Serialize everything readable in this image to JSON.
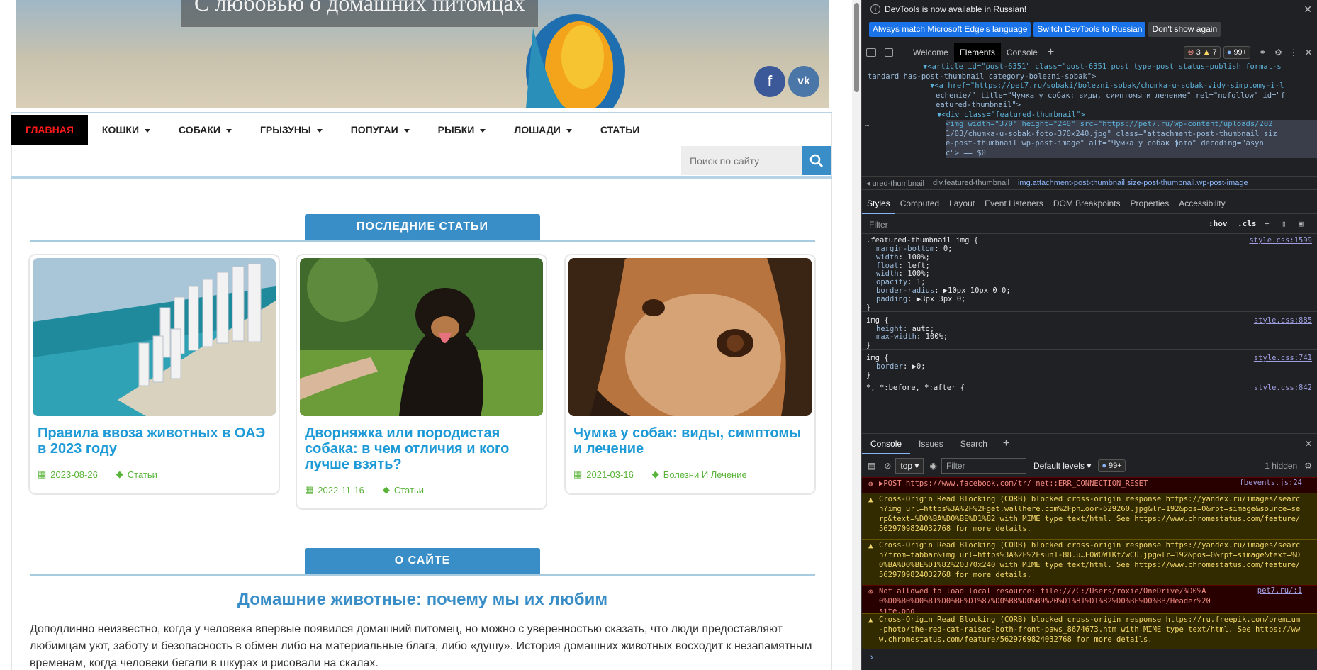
{
  "site": {
    "hero_title": "С любовью о домашних питомцах",
    "social": {
      "fb": "f",
      "vk": "vk"
    },
    "nav": [
      {
        "label": "ГЛАВНАЯ",
        "caret": false,
        "active": true
      },
      {
        "label": "КОШКИ",
        "caret": true
      },
      {
        "label": "СОБАКИ",
        "caret": true
      },
      {
        "label": "ГРЫЗУНЫ",
        "caret": true
      },
      {
        "label": "ПОПУГАИ",
        "caret": true
      },
      {
        "label": "РЫБКИ",
        "caret": true
      },
      {
        "label": "ЛОШАДИ",
        "caret": true
      },
      {
        "label": "СТАТЬИ",
        "caret": false
      }
    ],
    "search_placeholder": "Поиск по сайту",
    "latest_header": "ПОСЛЕДНИЕ СТАТЬИ",
    "articles": [
      {
        "title": "Правила ввоза животных в ОАЭ в 2023 году",
        "date": "2023-08-26",
        "category": "Статьи"
      },
      {
        "title": "Дворняжка или породистая собака: в чем отличия и кого лучше взять?",
        "date": "2022-11-16",
        "category": "Статьи"
      },
      {
        "title": "Чумка у собак: виды, симптомы и лечение",
        "date": "2021-03-16",
        "category": "Болезни И Лечение"
      }
    ],
    "about_header": "О САЙТЕ",
    "about_title": "Домашние животные: почему мы их любим",
    "about_text": "Доподлинно  неизвестно, когда у человека впервые появился домашний питомец, но можно с уверенностью сказать, что люди предоставляют любимцам уют, заботу и безопасность в обмен либо на материальные блага, либо «душу». История домашних животных восходит к незапамятным временам, когда человеки бегали в шкурах и рисовали на скалах."
  },
  "devtools": {
    "notice": "DevTools is now available in Russian!",
    "notice_info_icon": "i",
    "btn_match": "Always match Microsoft Edge's language",
    "btn_switch": "Switch DevTools to Russian",
    "btn_dont": "Don't show again",
    "tabs": [
      "Welcome",
      "Elements",
      "Console"
    ],
    "errors": "3",
    "warnings": "7",
    "messages": "99+",
    "dom_lines": [
      {
        "t": "▼<article id=\"post-6351\" class=\"post-6351 post type-post status-publish format-s"
      },
      {
        "t": "tandard has-post-thumbnail category-bolezni-sobak\">"
      },
      {
        "t": "▼<a href=\"https://pet7.ru/sobaki/bolezni-sobak/chumka-u-sobak-vidy-simptomy-i-l"
      },
      {
        "t": "echenie/\" title=\"Чумка у собак: виды, симптомы и лечение\" rel=\"nofollow\" id=\"f"
      },
      {
        "t": "eatured-thumbnail\">"
      },
      {
        "t": "▼<div class=\"featured-thumbnail\">"
      },
      {
        "t": "<img width=\"370\" height=\"240\" src=\"https://pet7.ru/wp-content/uploads/202"
      },
      {
        "t": "1/03/chumka-u-sobak-foto-370x240.jpg\" class=\"attachment-post-thumbnail siz"
      },
      {
        "t": "e-post-thumbnail wp-post-image\" alt=\"Чумка у собак фото\" decoding=\"asyn"
      },
      {
        "t": "c\"> == $0"
      }
    ],
    "crumbs": [
      "◂ ured-thumbnail",
      "div.featured-thumbnail",
      "img.attachment-post-thumbnail.size-post-thumbnail.wp-post-image"
    ],
    "style_tabs": [
      "Styles",
      "Computed",
      "Layout",
      "Event Listeners",
      "DOM Breakpoints",
      "Properties",
      "Accessibility"
    ],
    "filter_placeholder": "Filter",
    "hov": ":hov",
    "cls": ".cls",
    "rules": [
      {
        "selector": ".featured-thumbnail img {",
        "source": "style.css:1599",
        "props": [
          [
            "margin-bottom",
            "0;",
            false
          ],
          [
            "width",
            "100%;",
            true
          ],
          [
            "float",
            "left;",
            false
          ],
          [
            "width",
            "100%;",
            false
          ],
          [
            "opacity",
            "1;",
            false
          ],
          [
            "border-radius",
            "▶10px 10px 0 0;",
            false
          ],
          [
            "padding",
            "▶3px 3px 0;",
            false
          ]
        ]
      },
      {
        "selector": "img {",
        "source": "style.css:885",
        "props": [
          [
            "height",
            "auto;",
            false
          ],
          [
            "max-width",
            "100%;",
            false
          ]
        ]
      },
      {
        "selector": "img {",
        "source": "style.css:741",
        "props": [
          [
            "border",
            "▶0;",
            false
          ]
        ]
      },
      {
        "selector": "*, *:before, *:after {",
        "source": "style.css:842",
        "props": []
      }
    ],
    "console_tabs": [
      "Console",
      "Issues",
      "Search"
    ],
    "context": "top",
    "console_filter": "Filter",
    "levels": "Default levels",
    "console_count": "99+",
    "hidden": "1 hidden",
    "console_msgs": [
      {
        "type": "err",
        "text": "▶POST https://www.facebook.com/tr/ net::ERR_CONNECTION_RESET",
        "src": "fbevents.js:24"
      },
      {
        "type": "warn",
        "text": "Cross-Origin Read Blocking (CORB) blocked cross-origin response https://yandex.ru/images/search?img_url=https%3A%2F%2Fget.wallhere.com%2Fph…oor-629260.jpg&lr=192&pos=0&rpt=simage&source=serp&text=%D0%BA%D0%BE%D1%82 with MIME type text/html. See https://www.chromestatus.com/feature/5629709824032768 for more details.",
        "src": ""
      },
      {
        "type": "warn",
        "text": "Cross-Origin Read Blocking (CORB) blocked cross-origin response https://yandex.ru/images/search?from=tabbar&img_url=https%3A%2F%2Fsun1-88.u…F0WOW1KfZwCU.jpg&lr=192&pos=0&rpt=simage&text=%D0%BA%D0%BE%D1%82%20370x240 with MIME type text/html. See https://www.chromestatus.com/feature/5629709824032768 for more details.",
        "src": ""
      },
      {
        "type": "err",
        "text": "Not allowed to load local resource: file:///C:/Users/roxie/OneDrive/%D0%A0%D0%B0%D0%B1%D0%BE%D1%87%D0%B8%D0%B9%20%D1%81%D1%82%D0%BE%D0%BB/Header%20site.png",
        "src": "pet7.ru/:1"
      },
      {
        "type": "warn",
        "text": "Cross-Origin Read Blocking (CORB) blocked cross-origin response https://ru.freepik.com/premium-photo/the-red-cat-raised-both-front-paws_8674673.htm with MIME type text/html. See https://www.chromestatus.com/feature/5629709824032768 for more details.",
        "src": ""
      }
    ],
    "prompt": "›"
  }
}
